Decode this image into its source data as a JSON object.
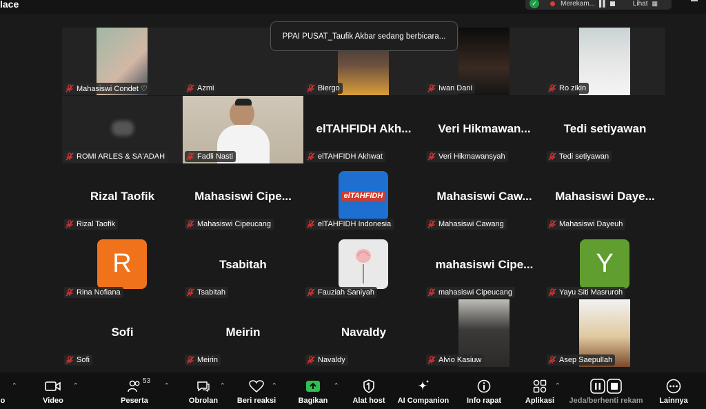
{
  "window": {
    "title_fragment": "lace"
  },
  "recording": {
    "label": "Merekam...",
    "view_label": "Lihat"
  },
  "toast": {
    "text": "PPAI PUSAT_Taufik Akbar sedang berbicara..."
  },
  "participants": [
    {
      "name": "Mahasiswi Condet ♡",
      "display": "",
      "kind": "photo",
      "muted": true
    },
    {
      "name": "Azmi",
      "display": "",
      "kind": "blank",
      "muted": true
    },
    {
      "name": "Biergo",
      "display": "",
      "kind": "photo",
      "muted": true
    },
    {
      "name": "Iwan Dani",
      "display": "",
      "kind": "photo",
      "muted": true
    },
    {
      "name": "Ro zikin",
      "display": "",
      "kind": "photo",
      "muted": true
    },
    {
      "name": "ROMI ARLES  & SA'ADAH",
      "display": "",
      "kind": "blur",
      "muted": true
    },
    {
      "name": "Fadli Nasti",
      "display": "",
      "kind": "video",
      "muted": true
    },
    {
      "name": "elTAHFIDH Akhwat",
      "display": "elTAHFIDH  Akh...",
      "kind": "text",
      "muted": true
    },
    {
      "name": "Veri Hikmawansyah",
      "display": "Veri  Hikmawan...",
      "kind": "text",
      "muted": true
    },
    {
      "name": "Tedi setiyawan",
      "display": "Tedi setiyawan",
      "kind": "text",
      "muted": true
    },
    {
      "name": "Rizal Taofik",
      "display": "Rizal Taofik",
      "kind": "text",
      "muted": true
    },
    {
      "name": "Mahasiswi Cipeucang",
      "display": "Mahasiswi  Cipe...",
      "kind": "text",
      "muted": true
    },
    {
      "name": "elTAHFIDH Indonesia",
      "display": "",
      "kind": "logo",
      "logo_text": "elTAHFIDH",
      "muted": true
    },
    {
      "name": "Mahasiswi Cawang",
      "display": "Mahasiswi  Caw...",
      "kind": "text",
      "muted": true
    },
    {
      "name": "Mahasiswi Dayeuh",
      "display": "Mahasiswi  Daye...",
      "kind": "text",
      "muted": true
    },
    {
      "name": "Rina Nofiana",
      "display": "",
      "kind": "avatar",
      "initial": "R",
      "color": "#f0731c",
      "muted": true
    },
    {
      "name": "Tsabitah",
      "display": "Tsabitah",
      "kind": "text",
      "muted": true
    },
    {
      "name": "Fauziah Saniyah",
      "display": "",
      "kind": "rose",
      "muted": true
    },
    {
      "name": "mahasiswi Cipeucang",
      "display": "mahasiswi  Cipe...",
      "kind": "text",
      "muted": true
    },
    {
      "name": "Yayu Siti Masruroh",
      "display": "",
      "kind": "avatar",
      "initial": "Y",
      "color": "#5f9e2f",
      "muted": true
    },
    {
      "name": "Sofi",
      "display": "Sofi",
      "kind": "text",
      "muted": true
    },
    {
      "name": "Meirin",
      "display": "Meirin",
      "kind": "text",
      "muted": true
    },
    {
      "name": "Navaldy",
      "display": "Navaldy",
      "kind": "text",
      "muted": true
    },
    {
      "name": "Alvio Kasiuw",
      "display": "",
      "kind": "photo",
      "muted": true
    },
    {
      "name": "Asep Saepullah",
      "display": "",
      "kind": "photo",
      "muted": true
    }
  ],
  "toolbar": {
    "audio_label": "o",
    "video_label": "Video",
    "participants_label": "Peserta",
    "participants_count": "53",
    "chat_label": "Obrolan",
    "reactions_label": "Beri reaksi",
    "share_label": "Bagikan",
    "host_label": "Alat host",
    "ai_label": "AI Companion",
    "info_label": "Info rapat",
    "apps_label": "Aplikasi",
    "record_label": "Jeda/berhenti rekam",
    "more_label": "Lainnya"
  },
  "colors": {
    "muted_red": "#e0312f",
    "share_green": "#2fc04f",
    "background": "#1a1a1a"
  }
}
